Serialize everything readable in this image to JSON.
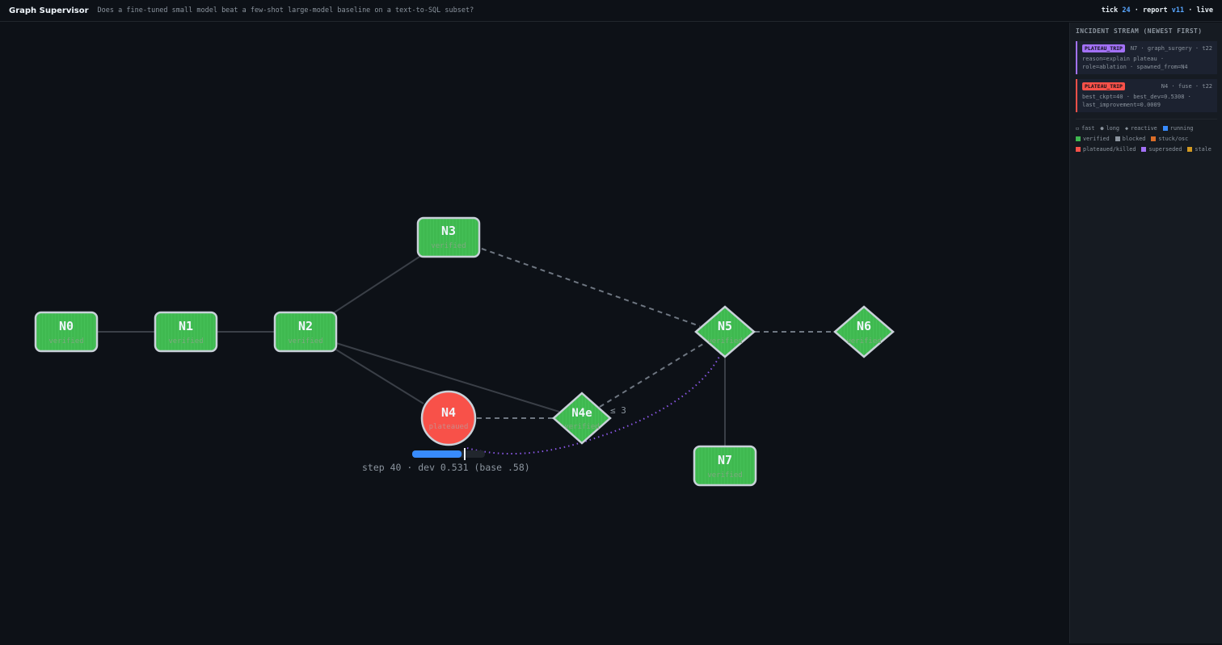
{
  "header": {
    "app_title": "Graph Supervisor",
    "question": "Does a fine-tuned small model beat a few-shot large-model baseline on a text-to-SQL subset?",
    "tick_label": "tick",
    "tick_value": "24",
    "report_label": "report",
    "report_value": "v11",
    "mode": "live"
  },
  "graph": {
    "nodes": {
      "n0": {
        "id": "N0",
        "status": "verified"
      },
      "n1": {
        "id": "N1",
        "status": "verified"
      },
      "n2": {
        "id": "N2",
        "status": "verified"
      },
      "n3": {
        "id": "N3",
        "status": "verified"
      },
      "n4": {
        "id": "N4",
        "status": "plateaued"
      },
      "n4e": {
        "id": "N4e",
        "status": "verified"
      },
      "n5": {
        "id": "N5",
        "status": "verified"
      },
      "n6": {
        "id": "N6",
        "status": "verified"
      },
      "n7": {
        "id": "N7",
        "status": "verified"
      }
    },
    "edge_label_n4e": "≤ 3",
    "n4_progress": {
      "fraction": 0.68,
      "caption": "step 40 · dev 0.531 (base .58)"
    }
  },
  "sidebar": {
    "title": "INCIDENT STREAM (NEWEST FIRST)",
    "incidents": [
      {
        "tag": "PLATEAU_TRIP",
        "meta": "N7 · graph_surgery · t22",
        "line1": "reason=explain plateau ·",
        "line2": "role=ablation · spawned_from=N4"
      },
      {
        "tag": "PLATEAU_TRIP",
        "meta": "N4 · fuse · t22",
        "line1": "best_ckpt=40 · best_dev=0.5308 ·",
        "line2": "last_improvement=0.0009"
      }
    ],
    "legend": {
      "fast": "fast",
      "long": "long",
      "reactive": "reactive",
      "running": "running",
      "verified": "verified",
      "blocked": "blocked",
      "stuck": "stuck/osc",
      "plateaued": "plateaued/killed",
      "superseded": "superseded",
      "stale": "stale"
    }
  },
  "colors": {
    "verified": "#3fb950",
    "running": "#388bfd",
    "plateaued": "#f85149",
    "blocked": "#8b949e",
    "stuck": "#db6d28",
    "superseded": "#a371f7",
    "stale": "#d29922"
  }
}
